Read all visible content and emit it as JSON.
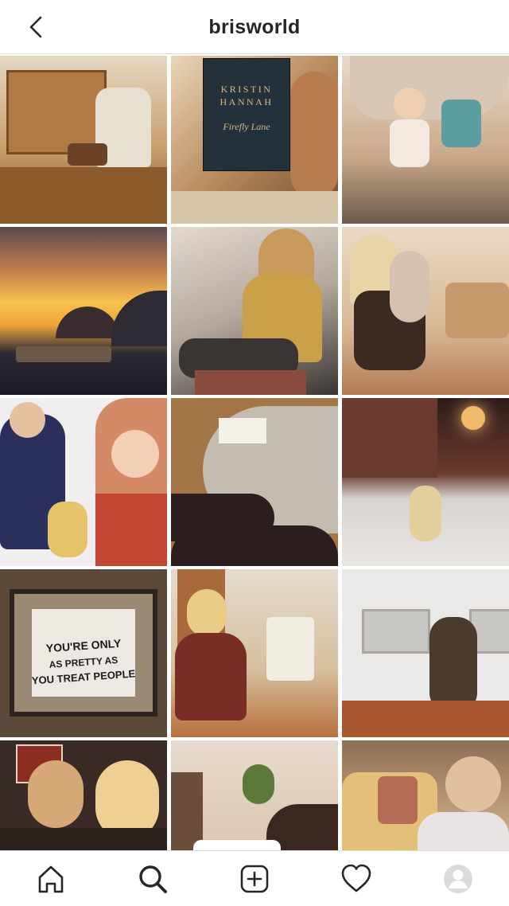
{
  "header": {
    "title": "brisworld",
    "back_icon": "chevron-left-icon"
  },
  "grid": {
    "tiles": [
      {
        "id": "record-shelf-backpack",
        "colors": [
          "#7a4a22",
          "#c49055",
          "#e7dfcf",
          "#3a2010"
        ]
      },
      {
        "id": "book-firefly-lane",
        "colors": [
          "#b98a5c",
          "#23313a",
          "#e9d6b8",
          "#6b4a2b"
        ],
        "book": {
          "author": "KRISTIN HANNAH",
          "title": "Firefly Lane"
        }
      },
      {
        "id": "girl-in-blanket-fort",
        "colors": [
          "#caa98a",
          "#6c5a4c",
          "#5c9ea0",
          "#e8dac8"
        ]
      },
      {
        "id": "sunset-over-bay",
        "colors": [
          "#f0a63a",
          "#f6c24e",
          "#2d2a33",
          "#5d4a50"
        ]
      },
      {
        "id": "mirror-selfie-yellow-sweater",
        "colors": [
          "#caa048",
          "#3a3533",
          "#e3d9cf",
          "#8a4c3e"
        ]
      },
      {
        "id": "mom-and-daughter-living-room",
        "colors": [
          "#d7b995",
          "#3a2a22",
          "#ecd9c6",
          "#b47a53"
        ]
      },
      {
        "id": "snow-selfie-with-toddler",
        "colors": [
          "#f0eeee",
          "#2a2f5c",
          "#d48a66",
          "#c0392b"
        ]
      },
      {
        "id": "boots-and-glass-table",
        "colors": [
          "#a37547",
          "#777066",
          "#c9c4bc",
          "#2a1f1c"
        ]
      },
      {
        "id": "snowy-night-street",
        "colors": [
          "#6b3a2e",
          "#e9e6e3",
          "#f2b96b",
          "#2d1c1a"
        ]
      },
      {
        "id": "you-treat-people-sign",
        "colors": [
          "#5a4838",
          "#ece9e2",
          "#2c2420",
          "#9a8a73"
        ],
        "sign": {
          "line1": "YOU'RE ONLY",
          "line2": "AS PRETTY AS",
          "line3": "YOU TREAT PEOPLE"
        }
      },
      {
        "id": "phone-selfie-hallway",
        "colors": [
          "#b9703d",
          "#e5dccf",
          "#7a2d25",
          "#3a2722"
        ]
      },
      {
        "id": "mom-holding-girl-tiles",
        "colors": [
          "#eae9e7",
          "#c9c7c4",
          "#4a3b2c",
          "#a8562e"
        ]
      },
      {
        "id": "couple-at-restaurant",
        "colors": [
          "#3a2a25",
          "#d6a777",
          "#f0cf95",
          "#8b2d20"
        ]
      },
      {
        "id": "coffee-mug-boots",
        "colors": [
          "#e8dbcd",
          "#6b4e3a",
          "#ffffff",
          "#b48a5d"
        ]
      },
      {
        "id": "girl-at-table-yellow-chair",
        "colors": [
          "#e2c07a",
          "#e9e4e4",
          "#b56b54",
          "#8c6f55"
        ]
      }
    ]
  },
  "bottom_nav": {
    "items": [
      {
        "name": "home",
        "icon": "home-icon"
      },
      {
        "name": "search",
        "icon": "search-icon"
      },
      {
        "name": "new-post",
        "icon": "plus-square-icon"
      },
      {
        "name": "activity",
        "icon": "heart-icon"
      },
      {
        "name": "profile",
        "icon": "avatar-icon"
      }
    ]
  }
}
